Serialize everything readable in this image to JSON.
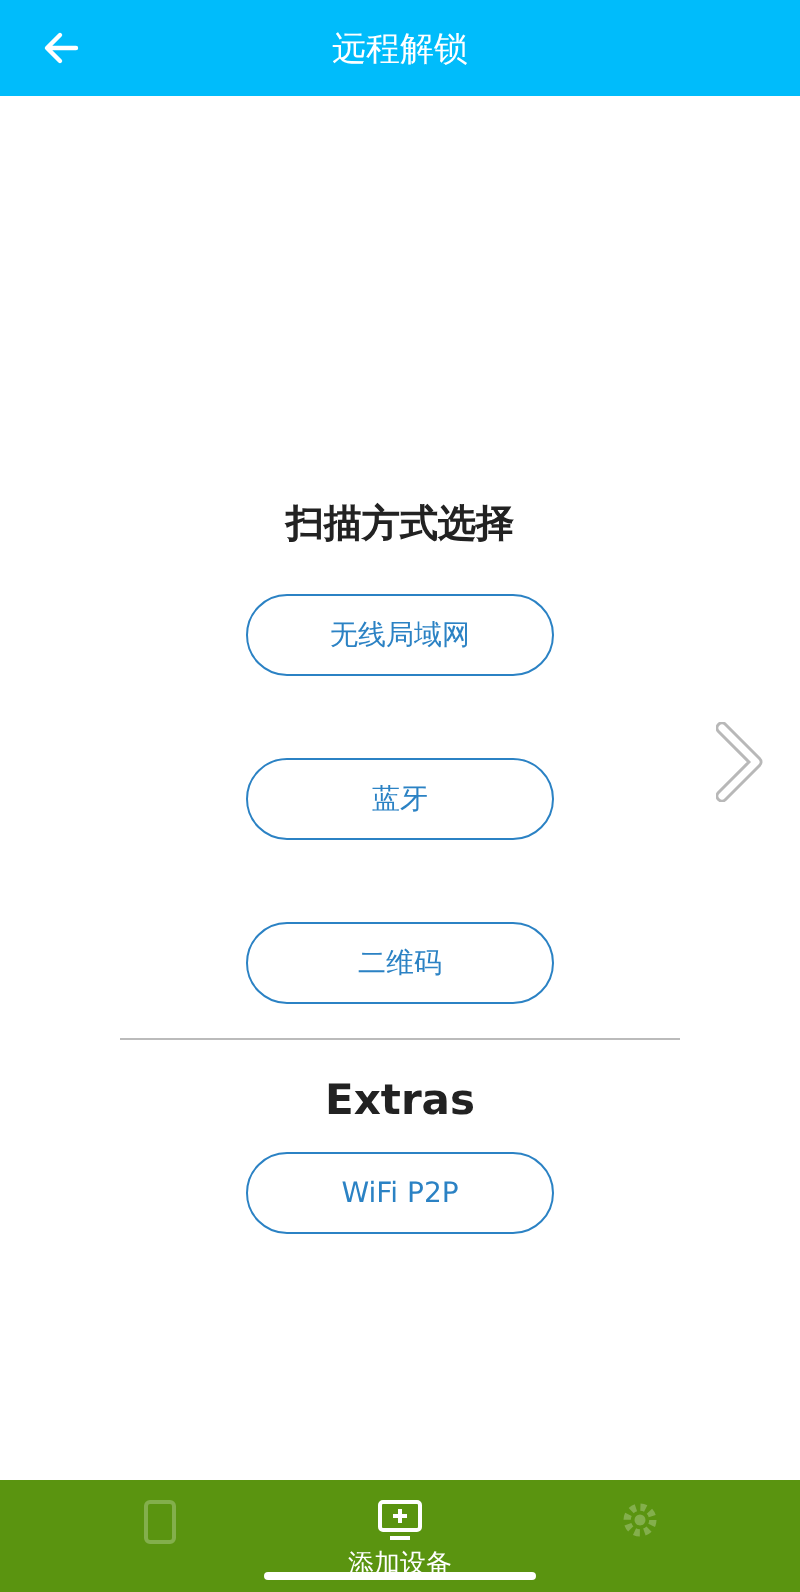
{
  "header": {
    "title": "远程解锁"
  },
  "scan": {
    "title": "扫描方式选择",
    "buttons": [
      "无线局域网",
      "蓝牙",
      "二维码"
    ]
  },
  "extras": {
    "title": "Extras",
    "buttons": [
      "WiFi P2P"
    ]
  },
  "tab_bar": [
    {
      "kind": "device",
      "selected": false
    },
    {
      "kind": "add",
      "selected": true,
      "label": "添加设备"
    },
    {
      "kind": "gear",
      "selected": false
    }
  ]
}
